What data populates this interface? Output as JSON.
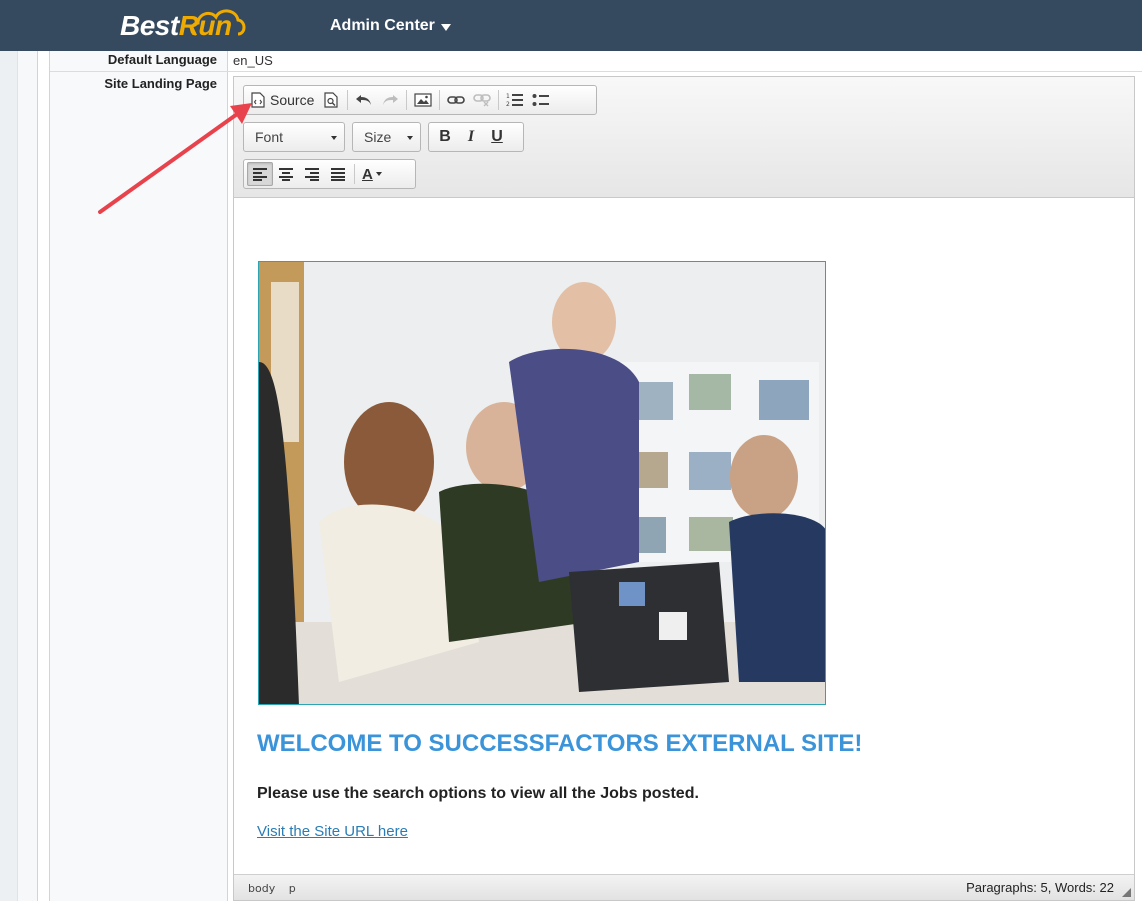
{
  "header": {
    "logo_text_a": "Best",
    "logo_text_b": "Run",
    "menu_label": "Admin Center"
  },
  "fields": {
    "default_language_label": "Default Language",
    "default_language_value": "en_US",
    "site_landing_label": "Site Landing Page"
  },
  "toolbar": {
    "source_label": "Source",
    "font_label": "Font",
    "size_label": "Size",
    "bold_label": "B",
    "italic_label": "I",
    "underline_label": "U",
    "text_color_label": "A"
  },
  "content": {
    "heading": "WELCOME TO SUCCESSFACTORS EXTERNAL SITE!",
    "paragraph": "Please use the search options to view all the Jobs posted.",
    "link_text": "Visit the Site URL here"
  },
  "statusbar": {
    "path_body": "body",
    "path_p": "p",
    "counts": "Paragraphs: 5, Words: 22"
  },
  "colors": {
    "header_bg": "#354a5f",
    "heading": "#3b94d9",
    "annotation_arrow": "#e8434c"
  }
}
